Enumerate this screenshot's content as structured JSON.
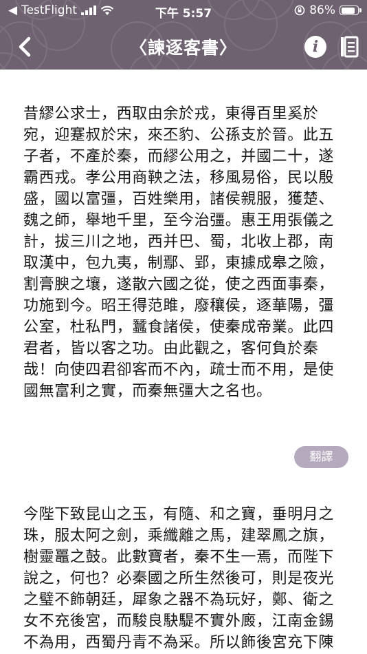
{
  "status_bar": {
    "carrier": "TestFlight",
    "time": "下午 5:57",
    "battery_percent": "86%",
    "battery_level": 0.86
  },
  "nav": {
    "title": "〈諫逐客書〉",
    "back_icon": "chevron-left-icon",
    "info_icon": "info-icon",
    "list_icon": "document-list-icon"
  },
  "content": {
    "paragraphs": [
      "昔繆公求士，西取由余於戎，東得百里奚於宛，迎蹇叔於宋，來丕豹、公孫支於晉。此五子者，不產於秦，而繆公用之，并國二十，遂霸西戎。孝公用商鞅之法，移風易俗，民以殷盛，國以富彊，百姓樂用，諸侯親服，獲楚、魏之師，舉地千里，至今治彊。惠王用張儀之計，拔三川之地，西并巴、蜀，北收上郡，南取漢中，包九夷，制鄢、郢，東據成皋之險，割膏腴之壤，遂散六國之從，使之西面事秦，功施到今。昭王得范雎，廢穰侯，逐華陽，彊公室，杜私門，蠶食諸侯，使秦成帝業。此四君者，皆以客之功。由此觀之，客何負於秦哉！向使四君卻客而不內，疏士而不用，是使國無富利之實，而秦無彊大之名也。",
      "今陛下致昆山之玉，有隨、和之寶，垂明月之珠，服太阿之劍，乘纖離之馬，建翠鳳之旗，樹靈鼉之鼓。此數寶者，秦不生一焉，而陛下說之，何也？必秦國之所生然後可，則是夜光之璧不飾朝廷，犀象之器不為玩好，鄭、衛之女不充後宮，而駿良駃騠不實外廄，江南金錫不為用，西蜀丹青不為采。所以飾後宮充下陳娛心意說耳目者，必出於秦然後可，"
    ],
    "translate_label": "翻譯"
  },
  "colors": {
    "header_bg": "#6e6270",
    "translate_button_bg": "#b5a9bd",
    "text": "#1a1a1a"
  }
}
